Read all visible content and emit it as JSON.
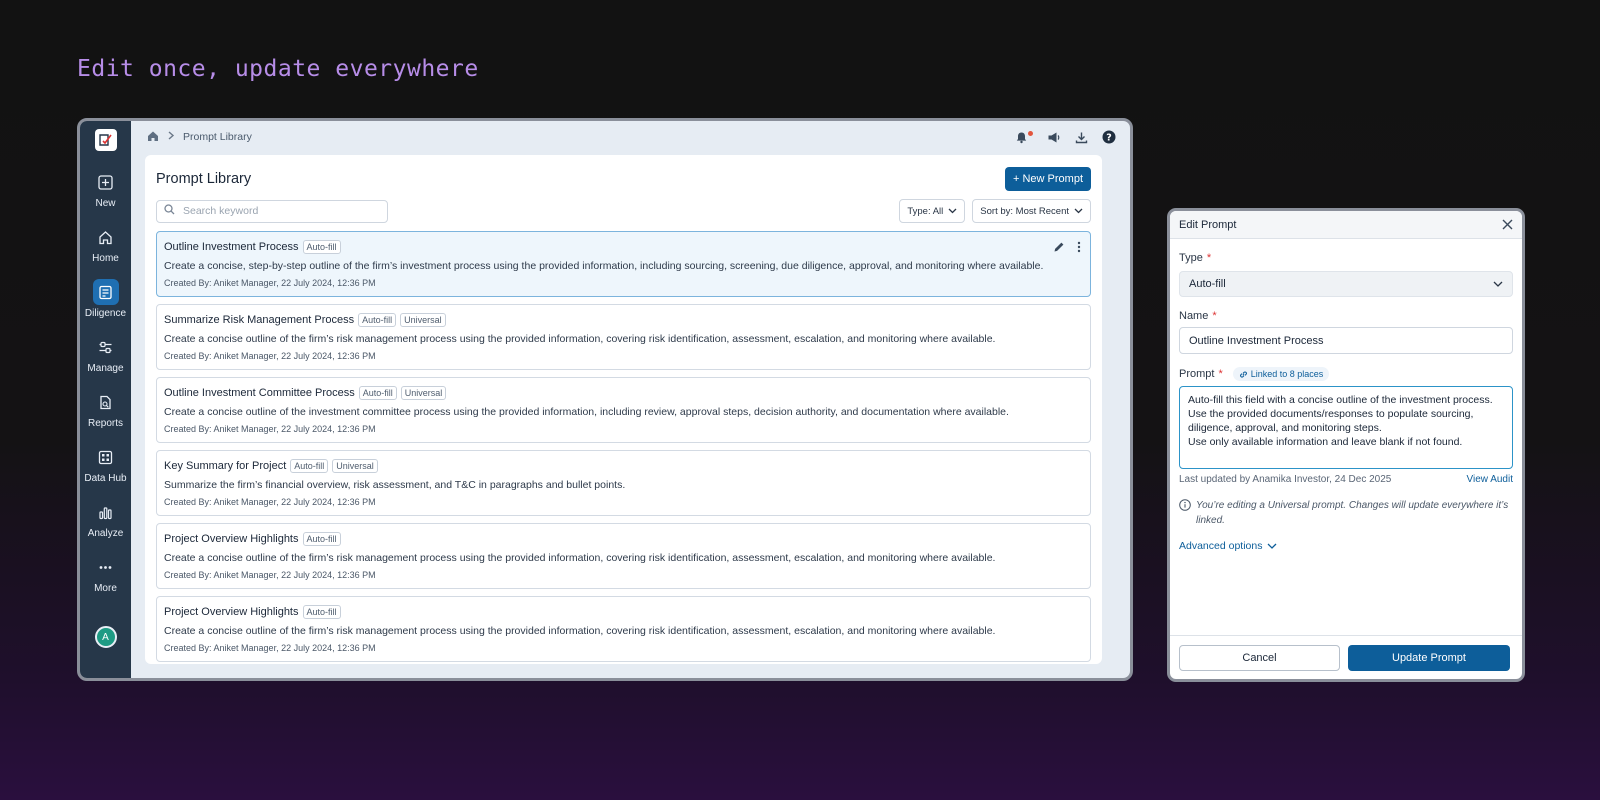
{
  "tagline": "Edit once, update everywhere",
  "sidebar": {
    "items": [
      {
        "label": "New",
        "icon": "plus-square-icon"
      },
      {
        "label": "Home",
        "icon": "home-icon"
      },
      {
        "label": "Diligence",
        "icon": "checklist-icon",
        "active": true
      },
      {
        "label": "Manage",
        "icon": "sliders-icon"
      },
      {
        "label": "Reports",
        "icon": "report-icon"
      },
      {
        "label": "Data Hub",
        "icon": "grid-icon"
      },
      {
        "label": "Analyze",
        "icon": "bar-chart-icon"
      },
      {
        "label": "More",
        "icon": "more-dots-icon"
      }
    ],
    "avatar_initial": "A"
  },
  "topbar": {
    "breadcrumb": "Prompt Library"
  },
  "library": {
    "title": "Prompt Library",
    "new_button": "+ New Prompt",
    "search_placeholder": "Search keyword",
    "type_filter": "Type: All",
    "sort_filter": "Sort by: Most Recent",
    "prompts": [
      {
        "title": "Outline Investment Process",
        "tags": [
          "Auto-fill"
        ],
        "description": "Create a concise, step-by-step outline of the firm’s investment process using the provided information, including sourcing, screening, due diligence, approval, and monitoring where available.",
        "meta": "Created By: Aniket Manager, 22 July 2024, 12:36 PM",
        "selected": true
      },
      {
        "title": "Summarize Risk Management Process",
        "tags": [
          "Auto-fill",
          "Universal"
        ],
        "description": "Create a concise outline of the firm’s risk management process using the provided information, covering risk identification, assessment, escalation, and monitoring where available.",
        "meta": "Created By: Aniket Manager, 22 July 2024, 12:36 PM"
      },
      {
        "title": "Outline Investment Committee Process",
        "tags": [
          "Auto-fill",
          "Universal"
        ],
        "description": "Create a concise outline of the investment committee process using the provided information, including review, approval steps, decision authority, and documentation where available.",
        "meta": "Created By: Aniket Manager, 22 July 2024, 12:36 PM"
      },
      {
        "title": "Key Summary for Project",
        "tags": [
          "Auto-fill",
          "Universal"
        ],
        "description": "Summarize the firm’s financial overview, risk assessment, and T&C in paragraphs and bullet points.",
        "meta": "Created By: Aniket Manager, 22 July 2024, 12:36 PM"
      },
      {
        "title": "Project Overview Highlights",
        "tags": [
          "Auto-fill"
        ],
        "description": "Create a concise outline of the firm’s risk management process using the provided information, covering risk identification, assessment, escalation, and monitoring where available.",
        "meta": "Created By: Aniket Manager, 22 July 2024, 12:36 PM"
      },
      {
        "title": "Project Overview Highlights",
        "tags": [
          "Auto-fill"
        ],
        "description": "Create a concise outline of the firm’s risk management process using the provided information, covering risk identification, assessment, escalation, and monitoring where available.",
        "meta": "Created By: Aniket Manager, 22 July 2024, 12:36 PM"
      }
    ]
  },
  "edit_modal": {
    "title": "Edit Prompt",
    "type_label": "Type",
    "type_value": "Auto-fill",
    "name_label": "Name",
    "name_value": "Outline Investment Process",
    "prompt_label": "Prompt",
    "linked_badge": "Linked to 8 places",
    "prompt_value": "Auto-fill this field with a concise outline of the investment process. Use the provided documents/responses to populate sourcing, diligence, approval, and monitoring steps.\nUse only available information and leave blank if not found.",
    "last_updated": "Last updated by Anamika Investor, 24 Dec 2025",
    "view_audit": "View Audit",
    "info_text": "You’re editing a Universal prompt. Changes will update everywhere it’s linked.",
    "advanced_options": "Advanced options",
    "cancel_label": "Cancel",
    "update_label": "Update Prompt",
    "required_mark": "*"
  },
  "colors": {
    "accent": "#0d5e9a",
    "sidebar": "#263749",
    "tagline": "#b78de8",
    "active_nav": "#1f6fb2"
  }
}
